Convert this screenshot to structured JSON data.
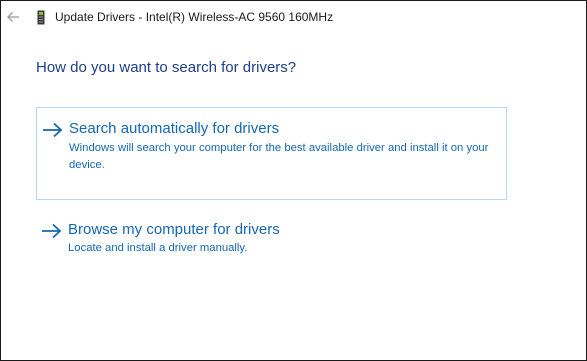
{
  "window": {
    "title": "Update Drivers - Intel(R) Wireless-AC 9560 160MHz"
  },
  "icons": {
    "back": "back-arrow-icon",
    "device": "network-adapter-icon",
    "option": "right-arrow-icon"
  },
  "main": {
    "heading": "How do you want to search for drivers?",
    "options": [
      {
        "title": "Search automatically for drivers",
        "description": "Windows will search your computer for the best available driver and install it on your device.",
        "selected": true
      },
      {
        "title": "Browse my computer for drivers",
        "description": "Locate and install a driver manually.",
        "selected": false
      }
    ]
  },
  "colors": {
    "heading": "#1e3d8a",
    "link": "#1467b1",
    "selection_border": "#b9d7ea"
  }
}
